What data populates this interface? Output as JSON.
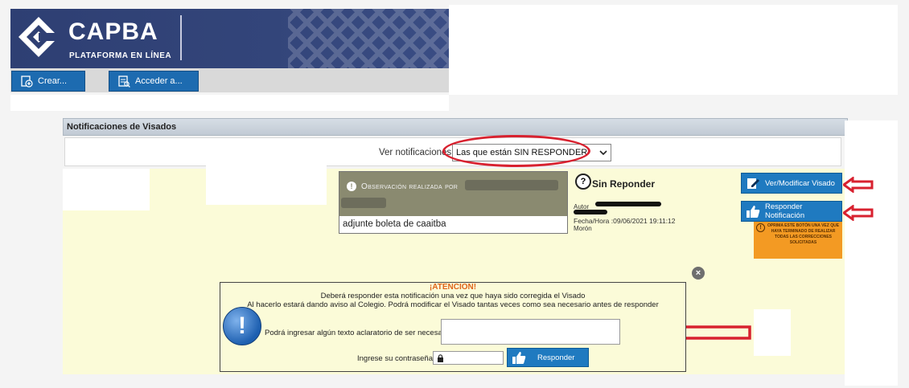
{
  "header": {
    "brand": "CAPBA",
    "subtitle": "PLATAFORMA EN LÍNEA",
    "colors": {
      "brand_blue": "#2e3f73",
      "button_blue": "#1d6bb0"
    }
  },
  "navbar": {
    "crear_label": "Crear...",
    "acceder_label": "Acceder a..."
  },
  "section": {
    "title": "Notificaciones de Visados",
    "filter_label": "Ver notificaciones:",
    "filter_value": "Las que están SIN RESPONDER"
  },
  "observation": {
    "header": "Observación realizada por",
    "text": "adjunte boleta de caaitba"
  },
  "status": {
    "label": "Sin Reponder",
    "autor_label": "Autor",
    "fecha": "Fecha/Hora :09/06/2021 19:11:12",
    "lugar": "Morón"
  },
  "actions": {
    "ver_label": "Ver/Modificar Visado",
    "responder_label": "Responder Notificación",
    "note": "Oprima este botón una vez que haya terminado de realizar todas las correcciones solicitadas"
  },
  "dialog": {
    "atencion": "¡ATENCION!",
    "line1": "Deberá responder esta notificación una vez que haya sido corregida el Visado",
    "line2": "Al hacerlo estará dando aviso al Colegio. Podrá modificar el Visado tantas veces como sea necesario antes de responder",
    "comment_label": "Podrá ingresar algún texto aclaratorio de ser necesario:",
    "comment_value": "",
    "password_label": "Ingrese su contraseña:",
    "responder_label": "Responder"
  },
  "icons": [
    "capba-logo-icon",
    "crear-icon",
    "acceder-icon",
    "info-icon",
    "question-icon",
    "edit-icon",
    "thumbs-up-icon",
    "warning-icon",
    "close-icon",
    "lock-icon",
    "red-arrow-icon"
  ]
}
